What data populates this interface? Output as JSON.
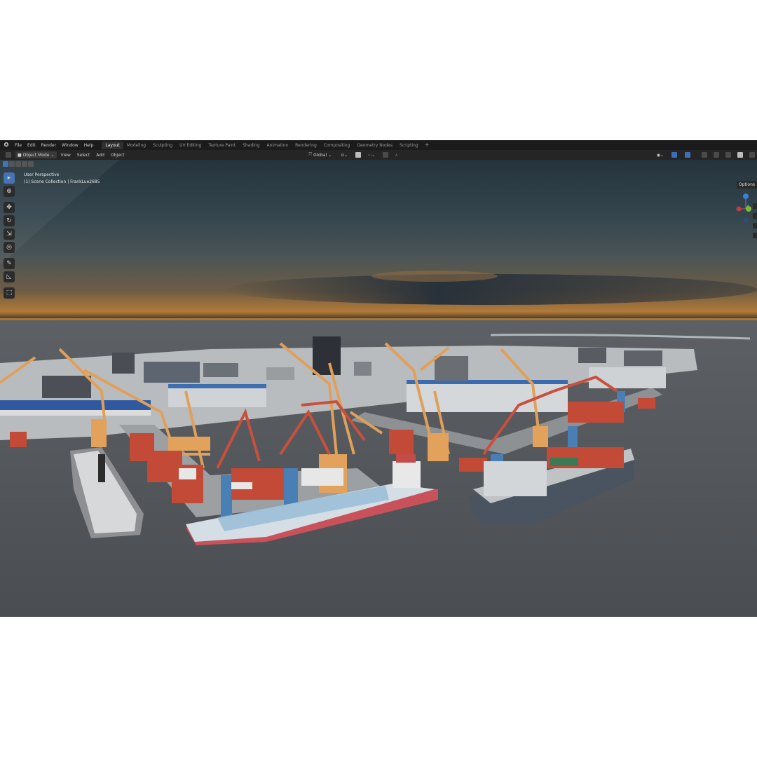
{
  "menu": {
    "items": [
      "File",
      "Edit",
      "Render",
      "Window",
      "Help"
    ]
  },
  "workspaces": [
    {
      "label": "Layout",
      "active": true
    },
    {
      "label": "Modeling",
      "active": false
    },
    {
      "label": "Sculpting",
      "active": false
    },
    {
      "label": "UV Editing",
      "active": false
    },
    {
      "label": "Texture Paint",
      "active": false
    },
    {
      "label": "Shading",
      "active": false
    },
    {
      "label": "Animation",
      "active": false
    },
    {
      "label": "Rendering",
      "active": false
    },
    {
      "label": "Compositing",
      "active": false
    },
    {
      "label": "Geometry Nodes",
      "active": false
    },
    {
      "label": "Scripting",
      "active": false
    }
  ],
  "workspace_add": "+",
  "header": {
    "mode": "Object Mode",
    "view": "View",
    "select": "Select",
    "add": "Add",
    "object": "Object",
    "transform_orientation": "Global"
  },
  "viewport": {
    "perspective": "User Perspective",
    "collection": "(1) Scene Collection | FrankLue2685",
    "options": "Options"
  },
  "colors": {
    "sky_top": "#2a3a44",
    "sky_horizon": "#b07a3a",
    "ground": "#4f5358",
    "crane_orange": "#e3a25c",
    "crane_blue": "#4a7fb5",
    "container_red": "#c24a36",
    "accent": "#4772b3"
  },
  "icons": {
    "tools": [
      "select-box-icon",
      "cursor-icon",
      "move-icon",
      "rotate-icon",
      "scale-icon",
      "transform-icon",
      "annotate-icon",
      "measure-icon",
      "add-cube-icon"
    ]
  }
}
